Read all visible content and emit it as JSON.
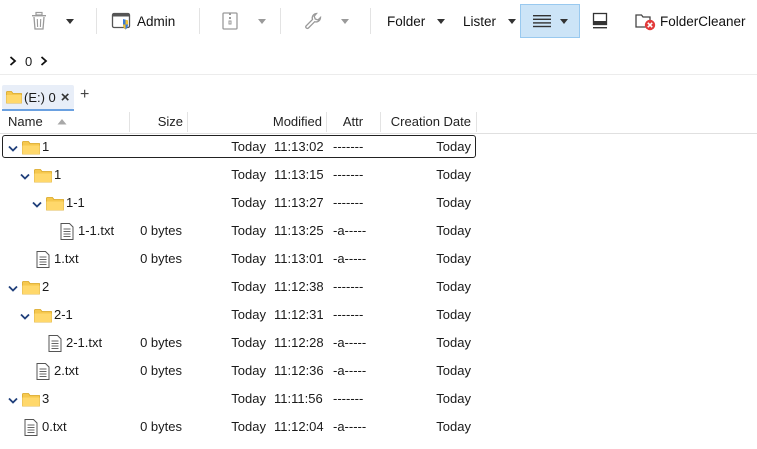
{
  "toolbar": {
    "admin_label": "Admin",
    "folder_label": "Folder",
    "lister_label": "Lister",
    "foldercleaner_label": "FolderCleaner"
  },
  "pathbar": {
    "crumb": "0"
  },
  "tab": {
    "label": "(E:) 0",
    "close": "×",
    "add": "+"
  },
  "columns": {
    "name": "Name",
    "size": "Size",
    "modified": "Modified",
    "attr": "Attr",
    "created": "Creation Date"
  },
  "rows": [
    {
      "name": "1",
      "type": "folder",
      "level": 0,
      "expanded": true,
      "size": "",
      "date": "Today",
      "time": "11:13:02",
      "attr": "-------",
      "created": "Today"
    },
    {
      "name": "1",
      "type": "folder",
      "level": 1,
      "expanded": true,
      "size": "",
      "date": "Today",
      "time": "11:13:15",
      "attr": "-------",
      "created": "Today"
    },
    {
      "name": "1-1",
      "type": "folder",
      "level": 2,
      "expanded": true,
      "size": "",
      "date": "Today",
      "time": "11:13:27",
      "attr": "-------",
      "created": "Today"
    },
    {
      "name": "1-1.txt",
      "type": "file",
      "level": 3,
      "expanded": false,
      "size": "0 bytes",
      "date": "Today",
      "time": "11:13:25",
      "attr": "-a-----",
      "created": "Today"
    },
    {
      "name": "1.txt",
      "type": "file",
      "level": 1,
      "expanded": false,
      "size": "0 bytes",
      "date": "Today",
      "time": "11:13:01",
      "attr": "-a-----",
      "created": "Today"
    },
    {
      "name": "2",
      "type": "folder",
      "level": 0,
      "expanded": true,
      "size": "",
      "date": "Today",
      "time": "11:12:38",
      "attr": "-------",
      "created": "Today"
    },
    {
      "name": "2-1",
      "type": "folder",
      "level": 1,
      "expanded": true,
      "size": "",
      "date": "Today",
      "time": "11:12:31",
      "attr": "-------",
      "created": "Today"
    },
    {
      "name": "2-1.txt",
      "type": "file",
      "level": 2,
      "expanded": false,
      "size": "0 bytes",
      "date": "Today",
      "time": "11:12:28",
      "attr": "-a-----",
      "created": "Today"
    },
    {
      "name": "2.txt",
      "type": "file",
      "level": 1,
      "expanded": false,
      "size": "0 bytes",
      "date": "Today",
      "time": "11:12:36",
      "attr": "-a-----",
      "created": "Today"
    },
    {
      "name": "3",
      "type": "folder",
      "level": 0,
      "expanded": true,
      "size": "",
      "date": "Today",
      "time": "11:11:56",
      "attr": "-------",
      "created": "Today"
    },
    {
      "name": "0.txt",
      "type": "file",
      "level": 0,
      "expanded": false,
      "size": "0 bytes",
      "date": "Today",
      "time": "11:12:04",
      "attr": "-a-----",
      "created": "Today"
    }
  ],
  "icons": {
    "delete": "trash-icon",
    "admin": "admin-shield-icon",
    "archive": "zip-folder-icon",
    "tools": "wrench-icon",
    "view": "details-view-icon",
    "preview": "preview-pane-icon",
    "cleaner": "folder-cleaner-icon"
  },
  "colors": {
    "accent": "#cce4f7",
    "folder": "#f6c84e",
    "chevron": "#1f3f7a"
  }
}
